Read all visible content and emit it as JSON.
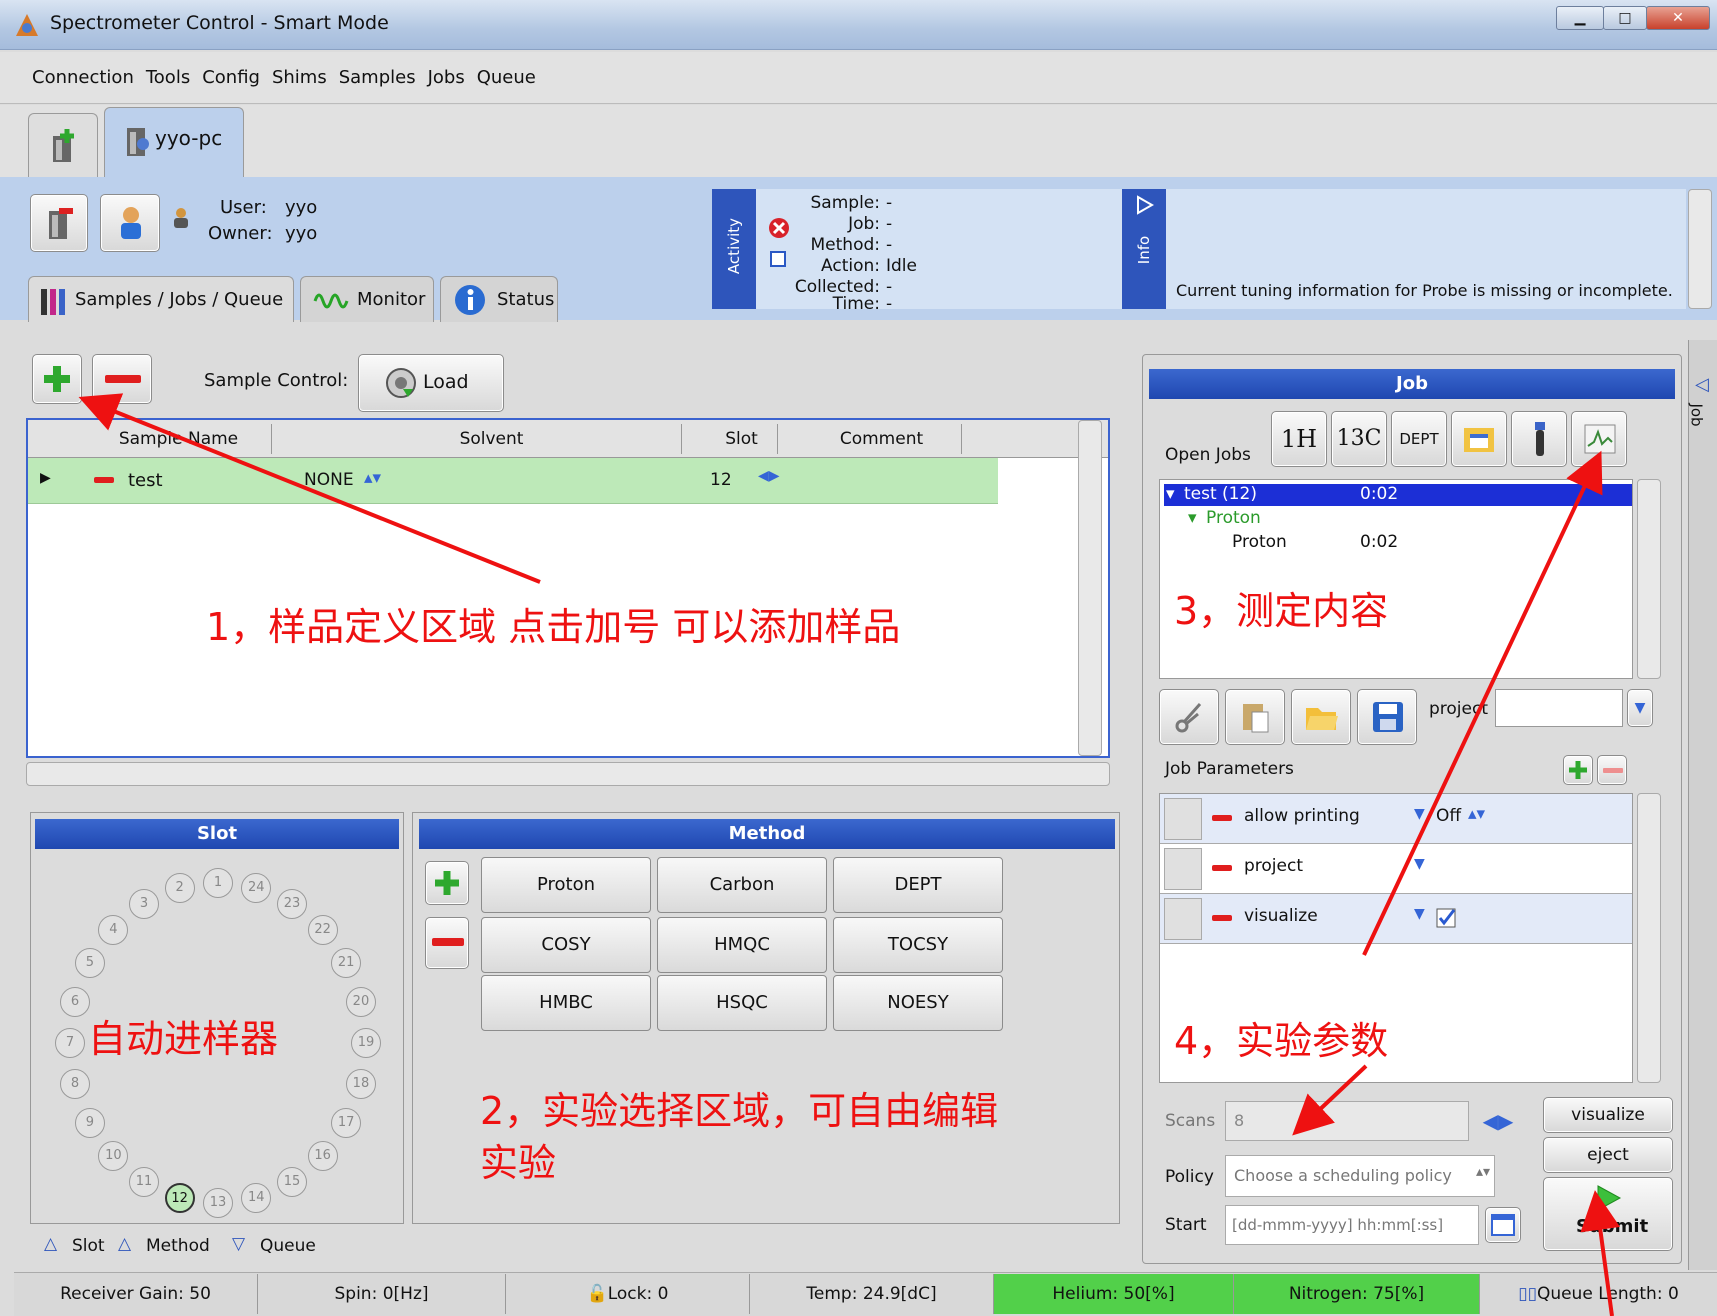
{
  "window": {
    "title": "Spectrometer Control - Smart Mode",
    "min": "▁",
    "max": "□",
    "close": "✕"
  },
  "menu": [
    "Connection",
    "Tools",
    "Config",
    "Shims",
    "Samples",
    "Jobs",
    "Queue"
  ],
  "tabs": {
    "host": "yyo-pc"
  },
  "user": {
    "user_label": "User:",
    "user_value": "yyo",
    "owner_label": "Owner:",
    "owner_value": "yyo"
  },
  "activity": {
    "label": "Activity",
    "sample_label": "Sample:",
    "sample_value": "-",
    "job_label": "Job:",
    "job_value": "-",
    "method_label": "Method:",
    "method_value": "-",
    "action_label": "Action:",
    "action_value": "Idle",
    "collected_label": "Collected:",
    "collected_value": "-",
    "time_label": "Time:",
    "time_value": "-"
  },
  "info": {
    "label": "Info",
    "message": "Current tuning information for Probe is missing or incomplete."
  },
  "subtabs": [
    "Samples / Jobs / Queue",
    "Monitor",
    "Status"
  ],
  "sample_control": {
    "label": "Sample Control:",
    "load": "Load"
  },
  "table": {
    "headers": [
      "Sample Name",
      "Solvent",
      "Slot",
      "Comment"
    ],
    "rows": [
      {
        "name": "test",
        "solvent": "NONE",
        "slot": "12",
        "comment": ""
      }
    ]
  },
  "slot_panel": {
    "title": "Slot",
    "slots": [
      "1",
      "2",
      "3",
      "4",
      "5",
      "6",
      "7",
      "8",
      "9",
      "10",
      "11",
      "12",
      "13",
      "14",
      "15",
      "16",
      "17",
      "18",
      "19",
      "20",
      "21",
      "22",
      "23",
      "24"
    ],
    "selected": "12"
  },
  "method_panel": {
    "title": "Method",
    "methods": [
      "Proton",
      "Carbon",
      "DEPT",
      "COSY",
      "HMQC",
      "TOCSY",
      "HMBC",
      "HSQC",
      "NOESY"
    ]
  },
  "bottom_tabs": [
    "Slot",
    "Method",
    "Queue"
  ],
  "job_panel": {
    "title": "Job",
    "side_label": "Job",
    "open_jobs": "Open Jobs",
    "job_buttons": [
      "1H",
      "13C",
      "DEPT"
    ],
    "tree": [
      {
        "label": "test (12)",
        "time": "0:02"
      },
      {
        "label": "Proton",
        "time": ""
      },
      {
        "label": "Proton",
        "time": "0:02"
      }
    ],
    "project_label": "project",
    "params_title": "Job Parameters",
    "params": [
      {
        "name": "allow printing",
        "value": "Off"
      },
      {
        "name": "project",
        "value": ""
      },
      {
        "name": "visualize",
        "value": ""
      }
    ],
    "scans_label": "Scans",
    "scans_value": "8",
    "policy_label": "Policy",
    "policy_placeholder": "Choose a scheduling policy",
    "start_label": "Start",
    "start_placeholder": "[dd-mmm-yyyy] hh:mm[:ss]",
    "visualize_btn": "visualize",
    "eject_btn": "eject",
    "submit_btn": "Submit"
  },
  "status": [
    "Receiver Gain: 50",
    "Spin: 0[Hz]",
    "Lock: 0",
    "Temp: 24.9[dC]",
    "Helium: 50[%]",
    "Nitrogen: 75[%]",
    "Queue Length: 0"
  ],
  "annotations": {
    "a1": "1，样品定义区域 点击加号 可以添加样品",
    "a2": "2，实验选择区域，可自由编辑",
    "a2b": "实验",
    "a3": "3，测定内容",
    "a4": "4，实验参数",
    "a5": "自动进样器"
  },
  "colors": {
    "accent": "#2149b5",
    "green": "#6fcf5a",
    "row": "#bde9b8",
    "annotation": "#ee1111"
  }
}
